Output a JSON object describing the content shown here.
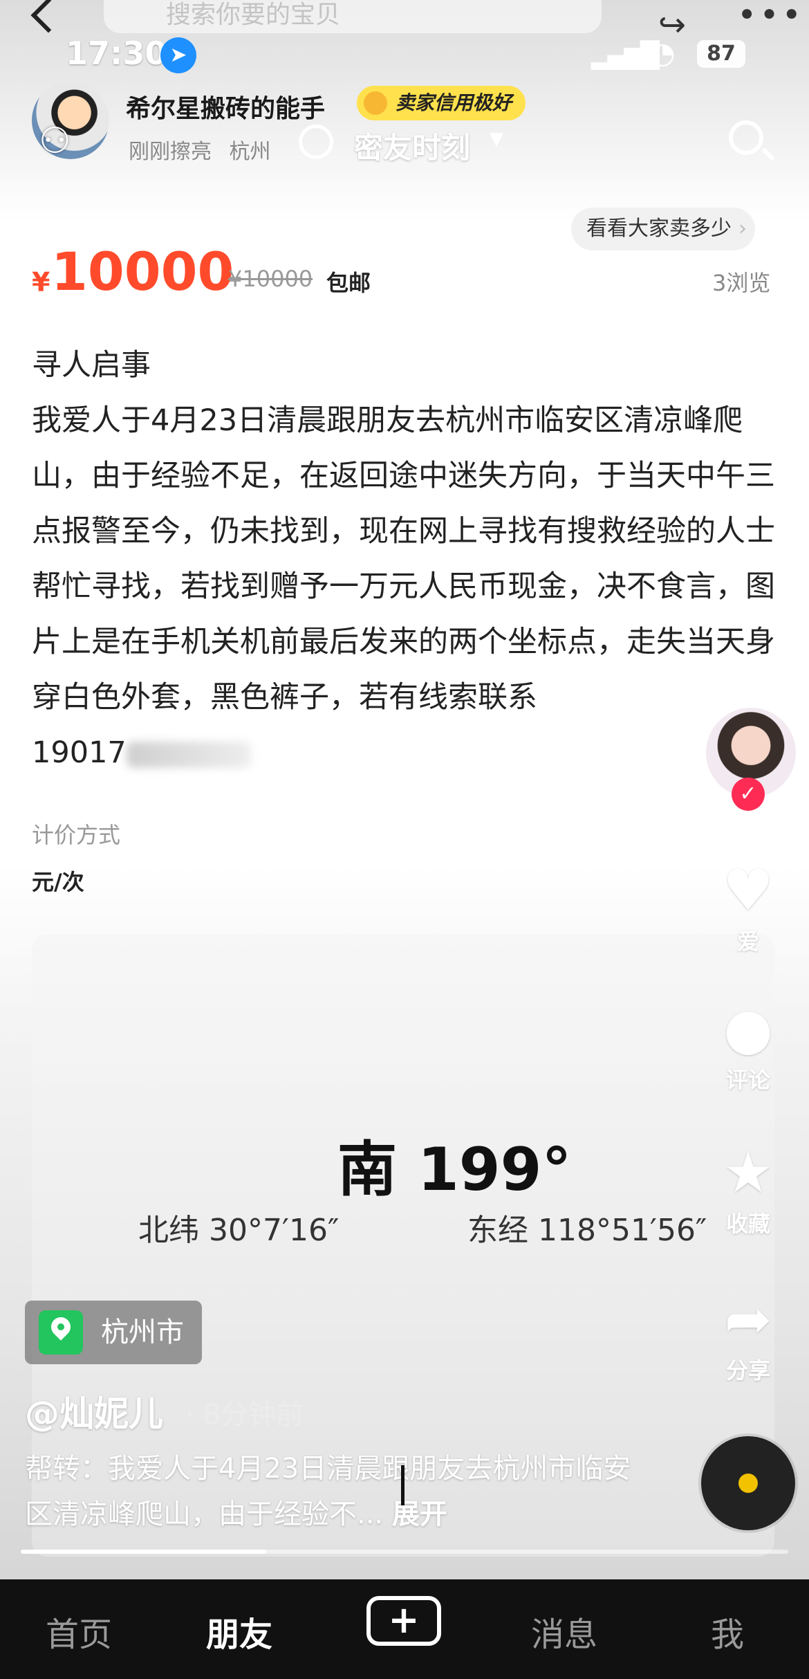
{
  "topbar": {
    "search_placeholder": "搜索你要的宝贝",
    "time": "17:30",
    "battery": "87"
  },
  "seller": {
    "name": "希尔星搬砖的能手",
    "badge": "卖家信用极好",
    "status": "刚刚擦亮",
    "city": "杭州",
    "friend_moment": "密友时刻"
  },
  "listing": {
    "see_sales": "看看大家卖多少",
    "currency": "¥",
    "price": "10000",
    "original_price": "¥10000",
    "shipping": "包邮",
    "views": "3浏览",
    "title": "寻人启事",
    "description": "我爱人于4月23日清晨跟朋友去杭州市临安区清凉峰爬山，由于经验不足，在返回途中迷失方向，于当天中午三点报警至今，仍未找到，现在网上寻找有搜救经验的人士帮忙寻找，若找到赠予一万元人民币现金，决不食言，图片上是在手机关机前最后发来的两个坐标点，走失当天身穿白色外套，黑色裤子，若有线索联系",
    "phone_visible": "19017",
    "price_method_label": "计价方式",
    "price_method": "元/次"
  },
  "image": {
    "heading": "南 199°",
    "latitude": "北纬 30°7′16″",
    "longitude": "东经 118°51′56″",
    "location_chip": "杭州市"
  },
  "video_overlay": {
    "username": "@灿妮儿",
    "time_ago": "· 8分钟前",
    "caption": "帮转：我爱人于4月23日清晨跟朋友去杭州市临安区清凉峰爬山，由于经验不...",
    "expand": "展开",
    "progress": 0.32
  },
  "rail": {
    "like_label": "爱",
    "comment_label": "评论",
    "favorite_label": "收藏",
    "share_label": "分享",
    "follow_glyph": "✓"
  },
  "bottom_nav": {
    "home": "首页",
    "friends": "朋友",
    "plus": "+",
    "messages": "消息",
    "me": "我"
  }
}
